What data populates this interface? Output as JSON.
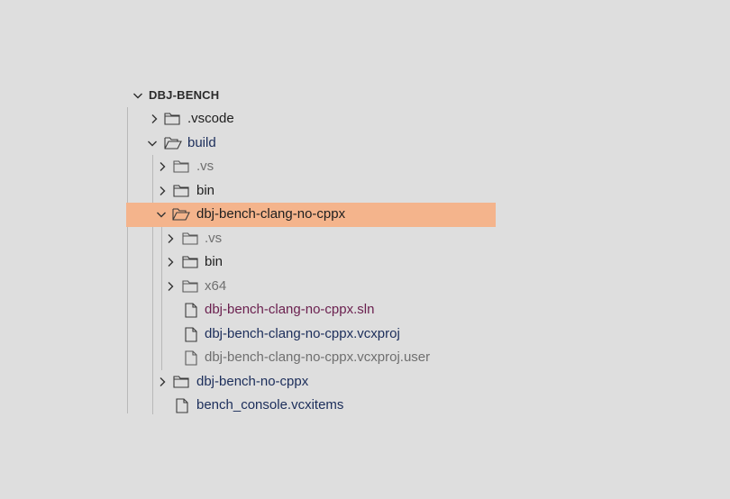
{
  "explorer": {
    "root_label": "DBJ-BENCH",
    "vscode": ".vscode",
    "build": "build",
    "build_vs": ".vs",
    "build_bin": "bin",
    "clang": "dbj-bench-clang-no-cppx",
    "clang_vs": ".vs",
    "clang_bin": "bin",
    "clang_x64": "x64",
    "clang_sln": "dbj-bench-clang-no-cppx.sln",
    "clang_vcxproj": "dbj-bench-clang-no-cppx.vcxproj",
    "clang_vcxproj_user": "dbj-bench-clang-no-cppx.vcxproj.user",
    "nocppx": "dbj-bench-no-cppx",
    "bench_console": "bench_console.vcxitems"
  },
  "colors": {
    "selection": "#f4b48c",
    "purple_file": "#6a1f4e",
    "navy_file": "#1b2d5a",
    "dim_file": "#6f6f6f"
  },
  "icons": {
    "chevron_right": "chevron-right-icon",
    "chevron_down": "chevron-down-icon",
    "folder_closed": "folder-icon",
    "folder_open": "folder-open-icon",
    "file": "file-icon"
  }
}
